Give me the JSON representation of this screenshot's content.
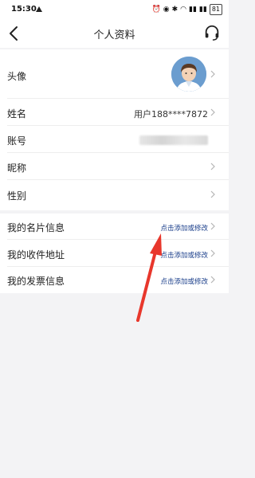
{
  "status_bar": {
    "time": "15:30",
    "battery": "81"
  },
  "header": {
    "title": "个人资料"
  },
  "profile": {
    "avatar_label": "头像",
    "name_label": "姓名",
    "name_value": "用户188****7872",
    "account_label": "账号",
    "nickname_label": "昵称",
    "gender_label": "性别"
  },
  "info": {
    "card_label": "我的名片信息",
    "card_link": "点击添加或修改",
    "address_label": "我的收件地址",
    "address_link": "点击添加或修改",
    "invoice_label": "我的发票信息",
    "invoice_link": "点击添加或修改"
  },
  "colors": {
    "link": "#1a3e8a",
    "arrow": "#e8372c",
    "avatar_bg": "#6b9dcf"
  }
}
